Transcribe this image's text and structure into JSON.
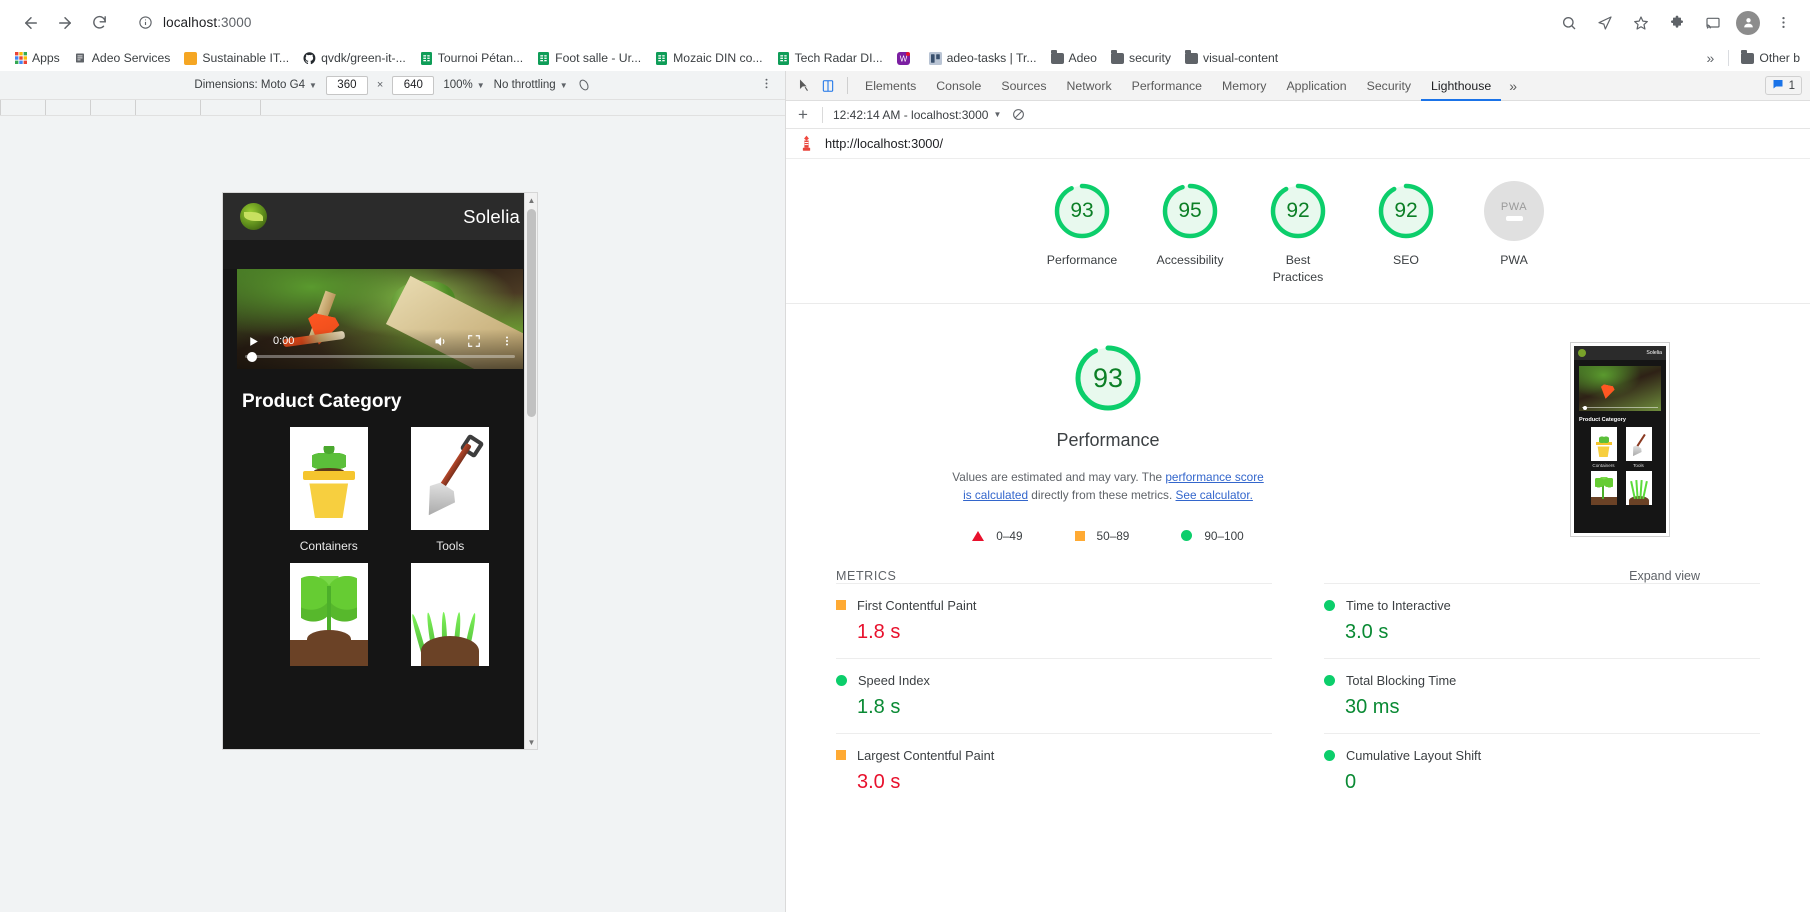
{
  "browser": {
    "url_bold": "localhost",
    "url_dim": ":3000",
    "back_icon": "back-arrow-icon",
    "forward_icon": "forward-arrow-icon",
    "reload_icon": "reload-icon",
    "info_icon": "page-info-icon",
    "search_icon": "search-icon",
    "send_icon": "send-icon",
    "star_icon": "bookmark-star-icon",
    "extensions_icon": "extensions-puzzle-icon",
    "cast_icon": "cast-icon",
    "menu_icon": "three-dot-menu-icon",
    "bookmarks": [
      {
        "label": "Apps",
        "icon": "apps-grid-icon",
        "color": "#4285f4"
      },
      {
        "label": "Adeo Services",
        "icon": "document-icon",
        "color": "#5f6368"
      },
      {
        "label": "Sustainable IT...",
        "icon": "square-icon",
        "color": "#f5a623"
      },
      {
        "label": "qvdk/green-it-...",
        "icon": "github-icon",
        "color": "#24292e"
      },
      {
        "label": "Tournoi Pétan...",
        "icon": "sheets-icon",
        "color": "#0f9d58"
      },
      {
        "label": "Foot salle - Ur...",
        "icon": "sheets-icon",
        "color": "#0f9d58"
      },
      {
        "label": "Mozaic DIN co...",
        "icon": "sheets-icon",
        "color": "#0f9d58"
      },
      {
        "label": "Tech Radar DI...",
        "icon": "sheets-icon",
        "color": "#0f9d58"
      },
      {
        "label": "",
        "icon": "whatsapp-w-icon",
        "color": "#7b1fa2"
      },
      {
        "label": "adeo-tasks | Tr...",
        "icon": "trello-icon",
        "color": "#8e9aaf"
      },
      {
        "label": "Adeo",
        "icon": "folder-icon",
        "color": "#5f6368"
      },
      {
        "label": "security",
        "icon": "folder-icon",
        "color": "#5f6368"
      },
      {
        "label": "visual-content",
        "icon": "folder-icon",
        "color": "#5f6368"
      }
    ],
    "overflow_label": "»",
    "other_bookmarks": "Other b"
  },
  "device_toolbar": {
    "dimensions_label": "Dimensions: Moto G4",
    "width": "360",
    "x_label": "×",
    "height": "640",
    "zoom": "100%",
    "throttling": "No throttling",
    "rotate_icon": "no-network-icon",
    "kebab_icon": "three-dot-menu-icon"
  },
  "site": {
    "brand": "Solelia",
    "logo_icon": "solelia-leaf-logo",
    "video": {
      "play_icon": "play-icon",
      "time": "0:00",
      "volume_icon": "volume-icon",
      "fullscreen_icon": "fullscreen-icon",
      "menu_icon": "three-dot-menu-icon"
    },
    "section_title": "Product Category",
    "categories": [
      {
        "label": "Containers",
        "icon": "flower-pot-image"
      },
      {
        "label": "Tools",
        "icon": "shovel-image"
      },
      {
        "label": "",
        "icon": "plant-image"
      },
      {
        "label": "",
        "icon": "grass-image"
      }
    ]
  },
  "devtools": {
    "inspect_icon": "inspect-element-icon",
    "device_toggle_icon": "device-toolbar-icon",
    "tabs": [
      "Elements",
      "Console",
      "Sources",
      "Network",
      "Performance",
      "Memory",
      "Application",
      "Security",
      "Lighthouse"
    ],
    "selected_tab": "Lighthouse",
    "more_tabs_icon": "»",
    "messages_icon": "message-icon",
    "messages_count": "1",
    "settings_icon": "gear-icon"
  },
  "lighthouse": {
    "new_report_icon": "plus-icon",
    "run_label": "12:42:14 AM - localhost:3000",
    "clear_icon": "clear-all-icon",
    "report_logo": "lighthouse-icon",
    "report_url": "http://localhost:3000/",
    "gauges": [
      {
        "label": "Performance",
        "score": "93",
        "value": 93,
        "state": "pass"
      },
      {
        "label": "Accessibility",
        "score": "95",
        "value": 95,
        "state": "pass"
      },
      {
        "label": "Best Practices",
        "score": "92",
        "value": 92,
        "state": "pass"
      },
      {
        "label": "SEO",
        "score": "92",
        "value": 92,
        "state": "pass"
      },
      {
        "label": "PWA",
        "score": "PWA",
        "value": 0,
        "state": "null"
      }
    ],
    "performance": {
      "score": "93",
      "title": "Performance",
      "note_pre": "Values are estimated and may vary. The ",
      "note_link1": "performance score is calculated",
      "note_mid": " directly from these metrics. ",
      "note_link2": "See calculator.",
      "legend": [
        {
          "range": "0–49",
          "marker": "triangle",
          "color": "#e8112d"
        },
        {
          "range": "50–89",
          "marker": "square",
          "color": "#ffaa33"
        },
        {
          "range": "90–100",
          "marker": "circle",
          "color": "#0cce6b"
        }
      ]
    },
    "metrics_section": {
      "title": "METRICS",
      "expand_label": "Expand view",
      "left": [
        {
          "name": "First Contentful Paint",
          "value": "1.8 s",
          "marker": "square",
          "value_color": "red"
        },
        {
          "name": "Speed Index",
          "value": "1.8 s",
          "marker": "circle",
          "value_color": "green"
        },
        {
          "name": "Largest Contentful Paint",
          "value": "3.0 s",
          "marker": "square",
          "value_color": "red"
        }
      ],
      "right": [
        {
          "name": "Time to Interactive",
          "value": "3.0 s",
          "marker": "circle",
          "value_color": "green"
        },
        {
          "name": "Total Blocking Time",
          "value": "30 ms",
          "marker": "circle",
          "value_color": "green"
        },
        {
          "name": "Cumulative Layout Shift",
          "value": "0",
          "marker": "circle",
          "value_color": "green"
        }
      ]
    },
    "thumbnail": {
      "brand": "Solelia",
      "section": "Product Category",
      "cap1": "Containers",
      "cap2": "Tools"
    }
  },
  "colors": {
    "pass_green": "#0cce6b",
    "score_text": "#0c7f26",
    "average_orange": "#ffaa33",
    "fail_red": "#e8112d",
    "accent_blue": "#1a73e8"
  }
}
